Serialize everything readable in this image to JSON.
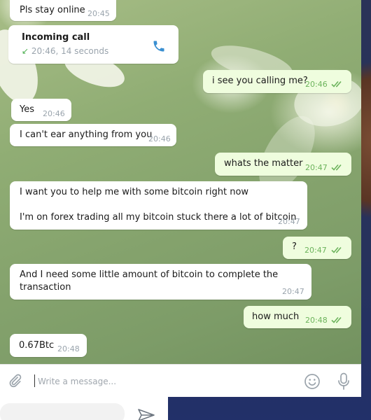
{
  "messages": [
    {
      "id": "m1",
      "dir": "in",
      "text": "Pls stay online",
      "time": "20:45"
    },
    {
      "id": "call",
      "dir": "in",
      "type": "call",
      "title": "Incoming call",
      "detail": "20:46, 14 seconds"
    },
    {
      "id": "m2",
      "dir": "out",
      "text": "i see you calling me?",
      "time": "20:46"
    },
    {
      "id": "m3",
      "dir": "in",
      "text": "Yes",
      "time": "20:46"
    },
    {
      "id": "m4",
      "dir": "in",
      "text": "I can't ear anything from you",
      "time": "20:46"
    },
    {
      "id": "m5",
      "dir": "out",
      "text": "whats the matter",
      "time": "20:47"
    },
    {
      "id": "m6",
      "dir": "in",
      "text": "I want you to help me with some bitcoin right now\n\nI'm on forex trading all my bitcoin stuck there a lot of bitcoin",
      "time": "20:47"
    },
    {
      "id": "m7",
      "dir": "out",
      "text": "?",
      "time": "20:47"
    },
    {
      "id": "m8",
      "dir": "in",
      "text": "And I need some little amount of bitcoin to complete the\ntransaction",
      "time": "20:47"
    },
    {
      "id": "m9",
      "dir": "out",
      "text": "how much",
      "time": "20:48"
    },
    {
      "id": "m10",
      "dir": "in",
      "text": "0.67Btc",
      "time": "20:48"
    }
  ],
  "composer": {
    "placeholder": "Write a message..."
  },
  "colors": {
    "incoming": "#ffffff",
    "outgoing": "#effdde",
    "tick": "#6cb35c",
    "call_arrow": "#4caf50",
    "accent": "#3a8fd1"
  }
}
